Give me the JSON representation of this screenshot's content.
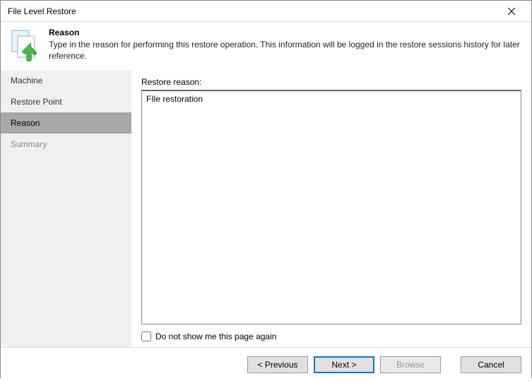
{
  "window": {
    "title": "File Level Restore"
  },
  "header": {
    "title": "Reason",
    "description": "Type in the reason for performing this restore operation. This information will be logged in the restore sessions history for later reference."
  },
  "sidebar": {
    "items": [
      {
        "label": "Machine",
        "state": "normal"
      },
      {
        "label": "Restore Point",
        "state": "normal"
      },
      {
        "label": "Reason",
        "state": "active"
      },
      {
        "label": "Summary",
        "state": "disabled"
      }
    ]
  },
  "main": {
    "reason_label": "Restore reason:",
    "reason_value": "FIle restoration",
    "checkbox_label": "Do not show me this page again",
    "checkbox_checked": false
  },
  "footer": {
    "previous": "< Previous",
    "next": "Next >",
    "browse": "Browse",
    "cancel": "Cancel"
  }
}
